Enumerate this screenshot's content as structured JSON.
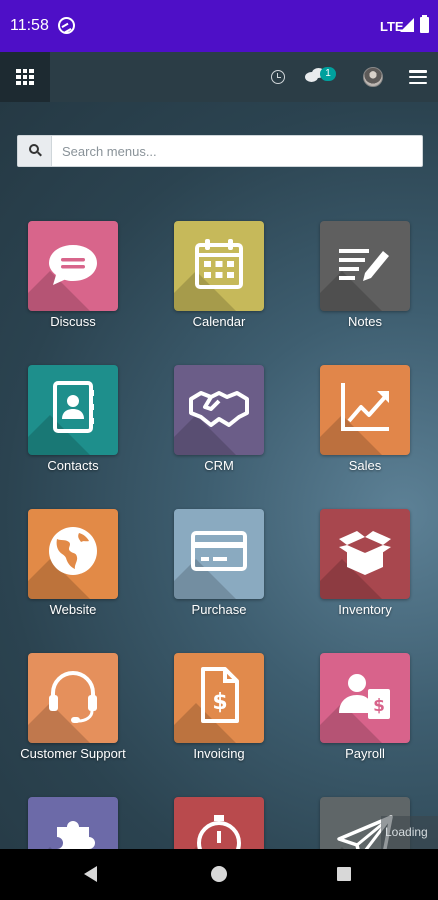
{
  "status_bar": {
    "time": "11:58",
    "network": "LTE"
  },
  "navbar": {
    "messages_count": "1"
  },
  "search": {
    "placeholder": "Search menus..."
  },
  "apps": [
    {
      "label": "Discuss",
      "icon": "discuss-icon",
      "color": "#d8658b"
    },
    {
      "label": "Calendar",
      "icon": "calendar-icon",
      "color": "#c6b95a"
    },
    {
      "label": "Notes",
      "icon": "notes-icon",
      "color": "#5f5f5f"
    },
    {
      "label": "Contacts",
      "icon": "contacts-icon",
      "color": "#1e8f8c"
    },
    {
      "label": "CRM",
      "icon": "handshake-icon",
      "color": "#6b5d88"
    },
    {
      "label": "Sales",
      "icon": "sales-chart-icon",
      "color": "#e1864a"
    },
    {
      "label": "Website",
      "icon": "globe-icon",
      "color": "#e28a47"
    },
    {
      "label": "Purchase",
      "icon": "credit-card-icon",
      "color": "#8aaac0"
    },
    {
      "label": "Inventory",
      "icon": "box-icon",
      "color": "#a8474e"
    },
    {
      "label": "Customer Support",
      "icon": "headset-icon",
      "color": "#e5905c"
    },
    {
      "label": "Invoicing",
      "icon": "invoice-icon",
      "color": "#e18a4c"
    },
    {
      "label": "Payroll",
      "icon": "payroll-icon",
      "color": "#d8638b"
    },
    {
      "label": "",
      "icon": "puzzle-icon",
      "color": "#6c6aa8"
    },
    {
      "label": "",
      "icon": "stopwatch-icon",
      "color": "#b94a4d"
    },
    {
      "label": "",
      "icon": "paper-plane-icon",
      "color": "#5f6668"
    }
  ],
  "loading_text": "Loading"
}
